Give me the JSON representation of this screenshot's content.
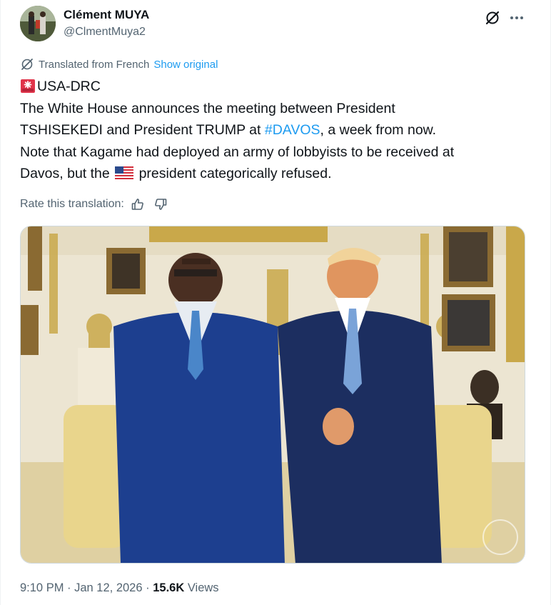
{
  "author": {
    "display_name": "Clément MUYA",
    "handle": "@ClmentMuya2"
  },
  "icons": {
    "grok": "grok-icon",
    "more": "more-dots-icon",
    "translate": "globe-icon",
    "thumbs_up": "thumbs-up-icon",
    "thumbs_down": "thumbs-down-icon",
    "siren": "rotating-light-emoji",
    "flag": "us-flag-emoji"
  },
  "translation": {
    "label": "Translated from French",
    "show_original": "Show original"
  },
  "tweet": {
    "line1": "USA-DRC",
    "line2": "The White House announces the meeting between President",
    "line3_pre": "TSHISEKEDI and President TRUMP at ",
    "hashtag": "#DAVOS",
    "line3_post": ", a week from now.",
    "line4": "Note that Kagame had deployed an army of lobbyists to be received at",
    "line5_pre": "Davos, but the ",
    "line5_post": " president categorically refused."
  },
  "rate": {
    "label": "Rate this translation:"
  },
  "meta": {
    "time": "9:10 PM",
    "separator": " · ",
    "date": "Jan 12, 2026",
    "views_count": "15.6K",
    "views_label": "Views"
  },
  "colors": {
    "link": "#1d9bf0",
    "secondary_text": "#536471",
    "primary_text": "#0f1419"
  }
}
